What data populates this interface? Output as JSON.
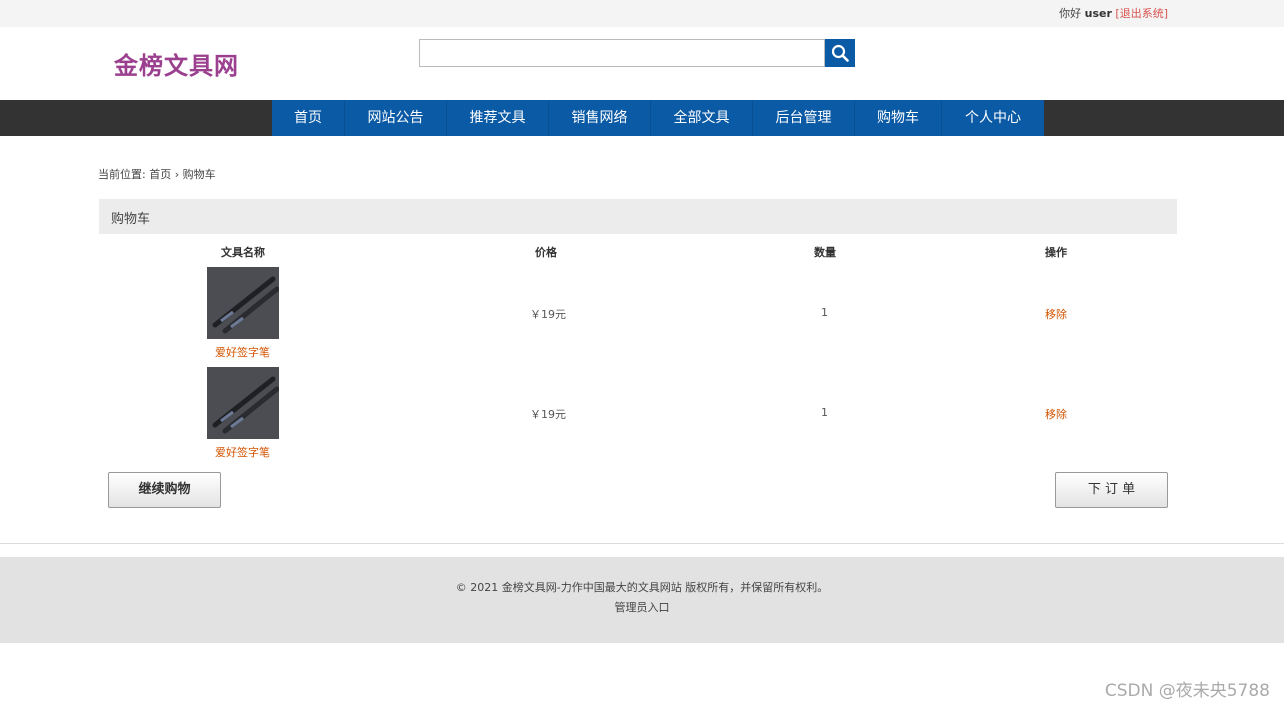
{
  "topbar": {
    "greeting": "你好",
    "username": "user",
    "logout": "[退出系统]"
  },
  "logo": "金榜文具网",
  "search": {
    "placeholder": "",
    "button_icon": "search-icon",
    "accent": "#0b5aa6"
  },
  "nav": {
    "items": [
      "首页",
      "网站公告",
      "推荐文具",
      "销售网络",
      "全部文具",
      "后台管理",
      "购物车",
      "个人中心"
    ]
  },
  "breadcrumb": {
    "prefix": "当前位置:",
    "home": "首页",
    "sep": "›",
    "current": "购物车"
  },
  "cart": {
    "title": "购物车",
    "columns": [
      "文具名称",
      "价格",
      "数量",
      "操作"
    ],
    "items": [
      {
        "name": "爱好签字笔",
        "price": "￥19元",
        "qty": "1",
        "action": "移除"
      },
      {
        "name": "爱好签字笔",
        "price": "￥19元",
        "qty": "1",
        "action": "移除"
      }
    ],
    "continue_label": "继续购物",
    "order_label": "下 订 单"
  },
  "footer": {
    "copyright": "© 2021 金榜文具网-力作中国最大的文具网站 版权所有，并保留所有权利。",
    "admin_link": "管理员入口"
  },
  "watermark": "CSDN @夜未央5788"
}
